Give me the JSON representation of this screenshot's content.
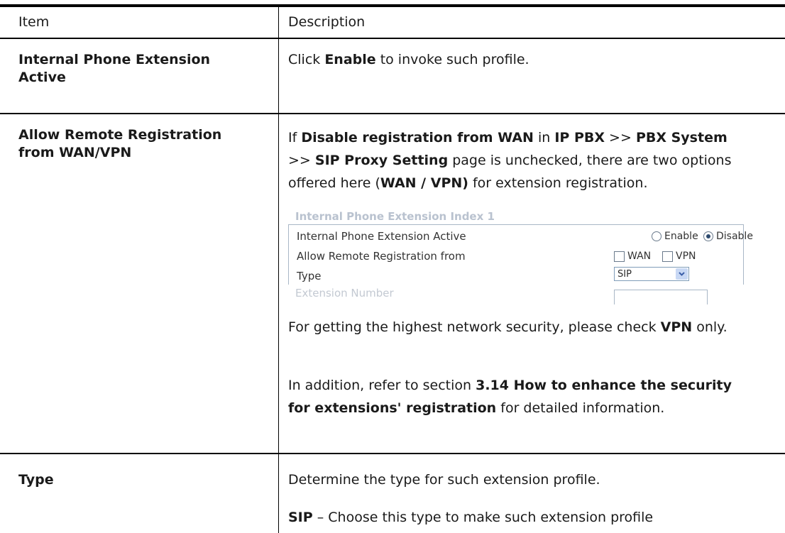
{
  "header": {
    "item": "Item",
    "description": "Description"
  },
  "rows": [
    {
      "item": "Internal Phone Extension Active"
    },
    {
      "item": "Allow Remote Registration from WAN/VPN"
    },
    {
      "item": "Type"
    }
  ],
  "row1": {
    "pre": "Click ",
    "b1": "Enable",
    "post": " to invoke such profile."
  },
  "row2": {
    "p1": {
      "t1": "If ",
      "b1": "Disable registration from WAN",
      "t2": " in ",
      "b2": "IP PBX",
      "t3": " >> ",
      "b3": "PBX System",
      "t4": " >> ",
      "b4": "SIP Proxy Setting",
      "t5": " page is unchecked, there are two options offered here (",
      "b5": "WAN / VPN)",
      "t6": " for extension registration."
    },
    "snippet": {
      "faded_title": "Internal Phone Extension Index 1",
      "active_label": "Internal Phone Extension Active",
      "enable_label": "Enable",
      "disable_label": "Disable",
      "remote_label": "Allow Remote Registration from",
      "wan_label": "WAN",
      "vpn_label": "VPN",
      "type_label": "Type",
      "type_value": "SIP",
      "faded_bottom": "Extension Number"
    },
    "p2": {
      "t1": "For getting the highest network security, please check ",
      "b1": "VPN",
      "t2": " only."
    },
    "p3": {
      "t1": "In addition, refer to section ",
      "b1": "3.14 How to enhance the security for extensions' registration",
      "t2": " for detailed information."
    }
  },
  "row3": {
    "p1": "Determine the type for such extension profile.",
    "p2": {
      "b1": "SIP",
      "t1": " – Choose this type to make such extension profile"
    }
  }
}
